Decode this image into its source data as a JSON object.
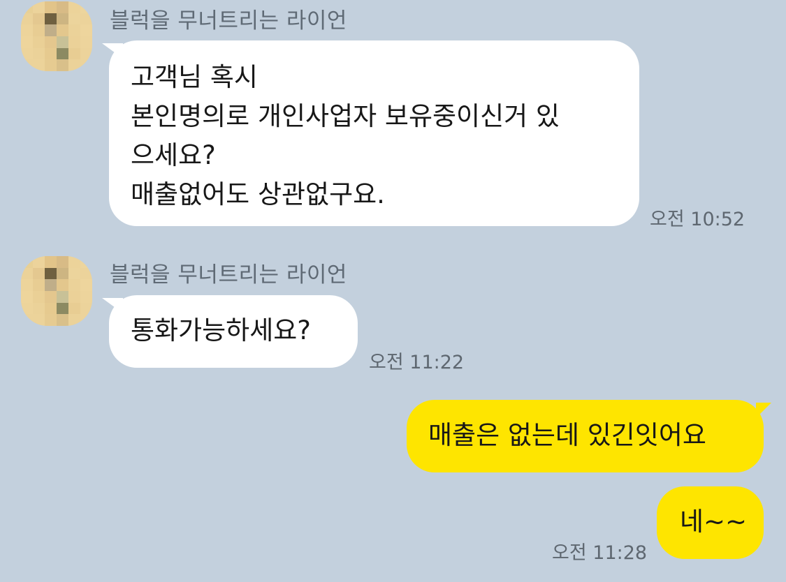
{
  "messages": [
    {
      "sender": "블럭을 무너트리는 라이언",
      "lines": [
        "고객님 혹시",
        "본인명의로 개인사업자 보유중이신거 있",
        "으세요?",
        "매출없어도 상관없구요."
      ],
      "time": "오전 10:52"
    },
    {
      "sender": "블럭을 무너트리는 라이언",
      "lines": [
        "통화가능하세요?"
      ],
      "time": "오전 11:22"
    },
    {
      "text": "매출은 없는데 있긴잇어요"
    },
    {
      "text": "네~~",
      "time": "오전 11:28"
    }
  ],
  "colors": {
    "background": "#c3d0dd",
    "incoming_bubble": "#ffffff",
    "outgoing_bubble": "#fee500"
  },
  "icons": {
    "avatar": "pixelated-profile-avatar"
  }
}
